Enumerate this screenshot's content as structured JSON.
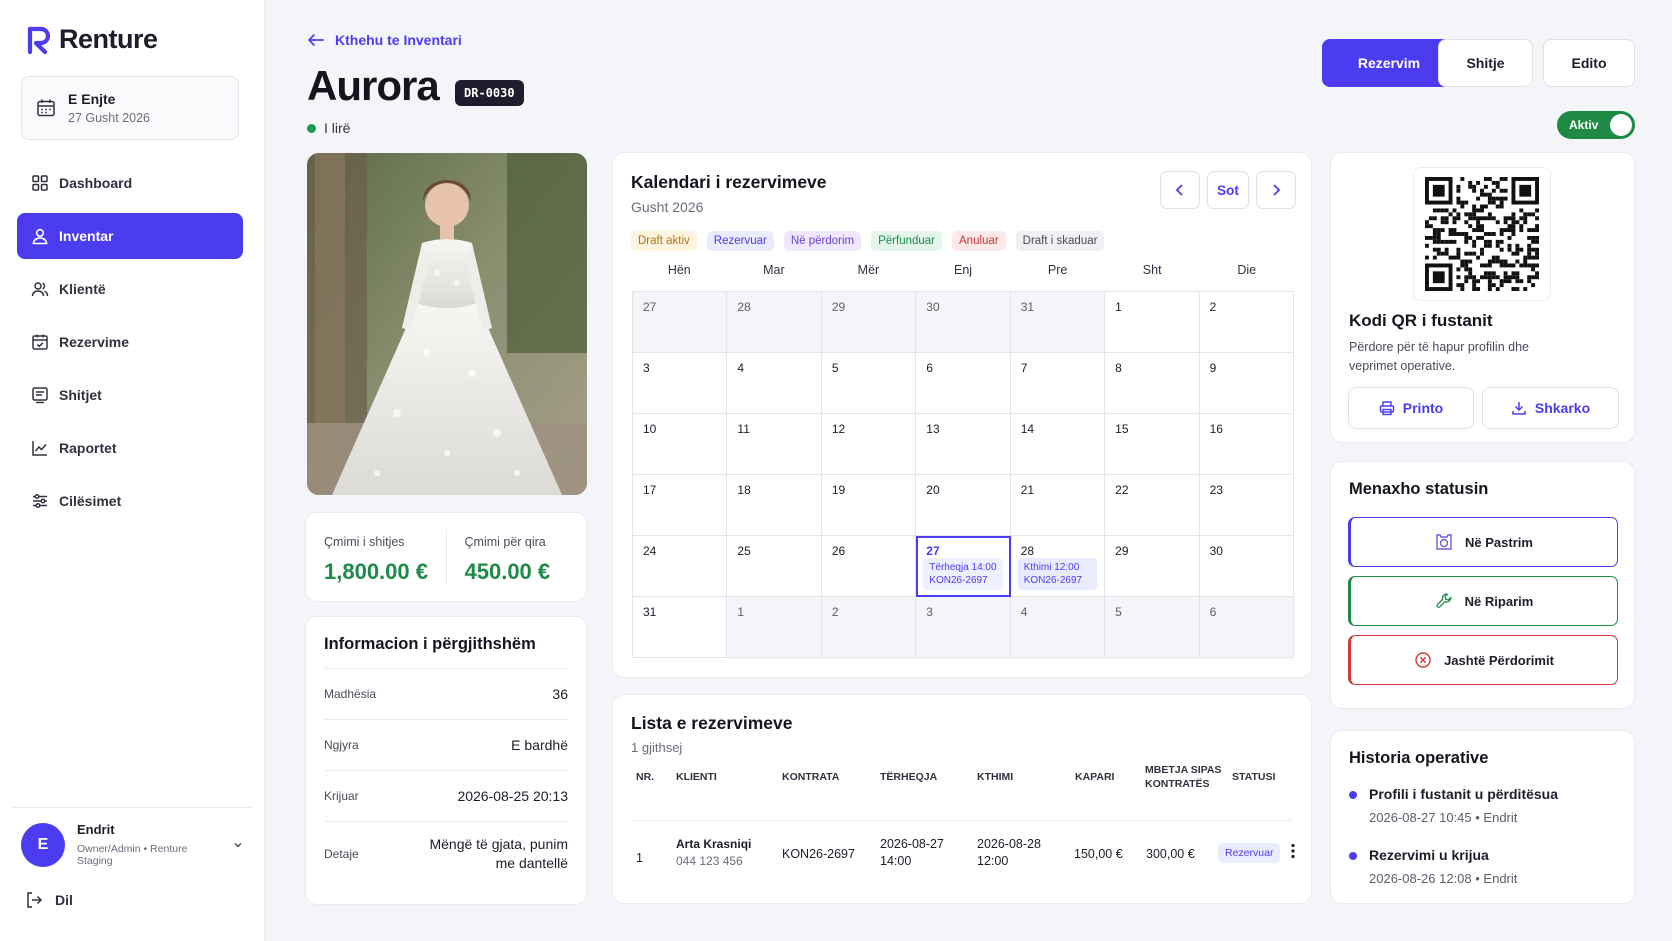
{
  "app": {
    "name": "Renture"
  },
  "date_card": {
    "weekday": "E Enjte",
    "date": "27 Gusht 2026"
  },
  "nav": [
    {
      "label": "Dashboard",
      "icon": "grid-icon"
    },
    {
      "label": "Inventar",
      "icon": "user-icon",
      "active": true
    },
    {
      "label": "Klientë",
      "icon": "users-icon"
    },
    {
      "label": "Rezervime",
      "icon": "calendar-check-icon"
    },
    {
      "label": "Shitjet",
      "icon": "receipt-icon"
    },
    {
      "label": "Raportet",
      "icon": "chart-icon"
    },
    {
      "label": "Cilësimet",
      "icon": "sliders-icon"
    }
  ],
  "user": {
    "initial": "E",
    "name": "Endrit",
    "role": "Owner/Admin • Renture Staging"
  },
  "logout": "Dil",
  "header": {
    "back": "Kthehu te Inventari",
    "title": "Aurora",
    "code": "DR-0030",
    "availability": "I lirë",
    "btn_reserve": "Rezervim",
    "btn_sell": "Shitje",
    "btn_edit": "Edito",
    "toggle": "Aktiv"
  },
  "prices": {
    "sale_label": "Çmimi i shitjes",
    "sale_value": "1,800.00 €",
    "rent_label": "Çmimi për qira",
    "rent_value": "450.00 €"
  },
  "info": {
    "title": "Informacion i përgjithshëm",
    "rows": [
      {
        "k": "Madhësia",
        "v": "36"
      },
      {
        "k": "Ngjyra",
        "v": "E bardhë"
      },
      {
        "k": "Krijuar",
        "v": "2026-08-25 20:13"
      },
      {
        "k": "Detaje",
        "v": "Mëngë të gjata, punim me dantellë"
      }
    ]
  },
  "calendar": {
    "title": "Kalendari i rezervimeve",
    "month": "Gusht 2026",
    "today_btn": "Sot",
    "legend": [
      {
        "label": "Draft aktiv",
        "bg": "#fff4e0",
        "fg": "#b5731a"
      },
      {
        "label": "Rezervuar",
        "bg": "#e9ecff",
        "fg": "#4c3cf0"
      },
      {
        "label": "Në përdorim",
        "bg": "#efe9ff",
        "fg": "#6a3fd4"
      },
      {
        "label": "Përfunduar",
        "bg": "#e4f5ea",
        "fg": "#1e8a4a"
      },
      {
        "label": "Anuluar",
        "bg": "#fde9e9",
        "fg": "#c93434"
      },
      {
        "label": "Draft i skaduar",
        "bg": "#f0f1f5",
        "fg": "#4a4c5b"
      }
    ],
    "weekdays": [
      "Hën",
      "Mar",
      "Mër",
      "Enj",
      "Pre",
      "Sht",
      "Die"
    ],
    "days": [
      {
        "d": "27",
        "out": true
      },
      {
        "d": "28",
        "out": true
      },
      {
        "d": "29",
        "out": true
      },
      {
        "d": "30",
        "out": true
      },
      {
        "d": "31",
        "out": true
      },
      {
        "d": "1"
      },
      {
        "d": "2"
      },
      {
        "d": "3"
      },
      {
        "d": "4"
      },
      {
        "d": "5"
      },
      {
        "d": "6"
      },
      {
        "d": "7"
      },
      {
        "d": "8"
      },
      {
        "d": "9"
      },
      {
        "d": "10"
      },
      {
        "d": "11"
      },
      {
        "d": "12"
      },
      {
        "d": "13"
      },
      {
        "d": "14"
      },
      {
        "d": "15"
      },
      {
        "d": "16"
      },
      {
        "d": "17"
      },
      {
        "d": "18"
      },
      {
        "d": "19"
      },
      {
        "d": "20"
      },
      {
        "d": "21"
      },
      {
        "d": "22"
      },
      {
        "d": "23"
      },
      {
        "d": "24"
      },
      {
        "d": "25"
      },
      {
        "d": "26"
      },
      {
        "d": "27",
        "today": true,
        "event": [
          "Tërheqja 14:00",
          "KON26-2697"
        ]
      },
      {
        "d": "28",
        "event": [
          "Kthimi 12:00",
          "KON26-2697"
        ]
      },
      {
        "d": "29"
      },
      {
        "d": "30"
      },
      {
        "d": "31"
      },
      {
        "d": "1",
        "out": true
      },
      {
        "d": "2",
        "out": true
      },
      {
        "d": "3",
        "out": true
      },
      {
        "d": "4",
        "out": true
      },
      {
        "d": "5",
        "out": true
      },
      {
        "d": "6",
        "out": true
      }
    ]
  },
  "bookings": {
    "title": "Lista e rezervimeve",
    "count": "1 gjithsej",
    "headers": [
      "NR.",
      "KLIENTI",
      "KONTRATA",
      "TËRHEQJA",
      "KTHIMI",
      "KAPARI",
      "MBETJA SIPAS",
      "KONTRATËS",
      "STATUSI"
    ],
    "row": {
      "nr": "1",
      "client": "Arta Krasniqi",
      "phone": "044 123 456",
      "contract": "KON26-2697",
      "pickup_date": "2026-08-27",
      "pickup_time": "14:00",
      "return_date": "2026-08-28",
      "return_time": "12:00",
      "deposit": "150,00 €",
      "remaining": "300,00 €",
      "status": "Rezervuar"
    }
  },
  "qr": {
    "title": "Kodi QR i fustanit",
    "desc": "Përdore për të hapur profilin dhe veprimet operative.",
    "print": "Printo",
    "download": "Shkarko"
  },
  "status_mgmt": {
    "title": "Menaxho statusin",
    "cleaning": "Në Pastrim",
    "repair": "Në Riparim",
    "out_of_use": "Jashtë Përdorimit"
  },
  "history": {
    "title": "Historia operative",
    "items": [
      {
        "t": "Profili i fustanit u përditësua",
        "s": "2026-08-27 10:45 • Endrit"
      },
      {
        "t": "Rezervimi u krijua",
        "s": "2026-08-26 12:08 • Endrit"
      }
    ]
  }
}
